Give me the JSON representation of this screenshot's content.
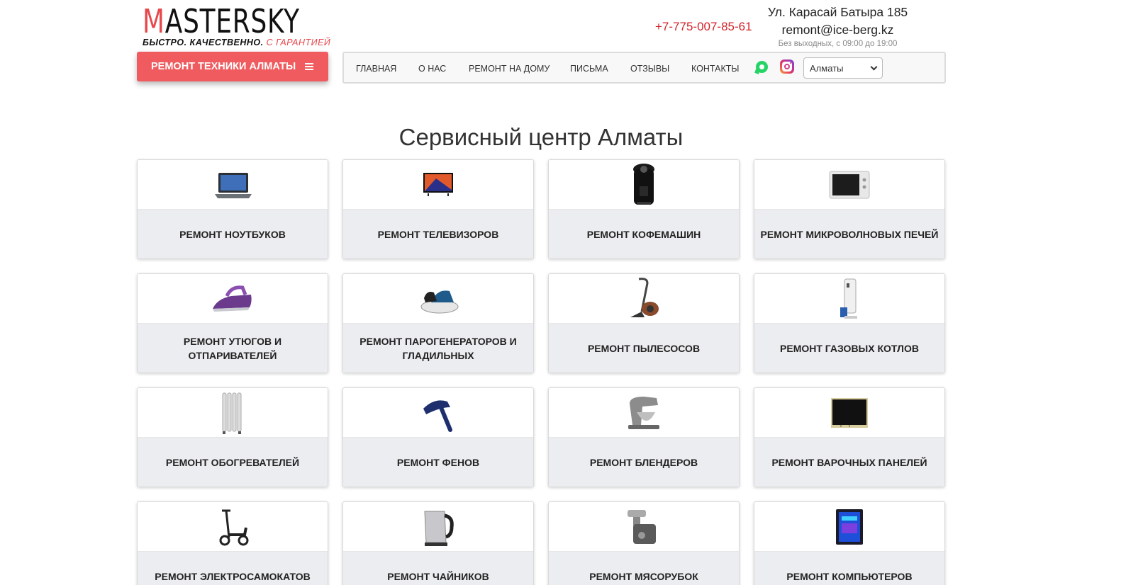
{
  "logo": {
    "first": "M",
    "rest": "ASTERSKY",
    "tagline_main": "БЫСТРО. КАЧЕСТВЕННО.",
    "tagline_accent": "С ГАРАНТИЕЙ"
  },
  "contacts": {
    "phone": "+7-775-007-85-61",
    "address": "Ул. Карасай Батыра 185",
    "email": "remont@ice-berg.kz",
    "hours": "Без выходных, с 09:00 до 19:00"
  },
  "category_button": {
    "label": "РЕМОНТ ТЕХНИКИ АЛМАТЫ",
    "icon": "hamburger-icon"
  },
  "nav": {
    "items": [
      "ГЛАВНАЯ",
      "О НАС",
      "РЕМОНТ НА ДОМУ",
      "ПИСЬМА",
      "ОТЗЫВЫ",
      "КОНТАКТЫ"
    ],
    "social": [
      "whatsapp-icon",
      "instagram-icon"
    ],
    "city_select": {
      "selected": "Алматы"
    }
  },
  "page_title": "Сервисный центр Алматы",
  "services": [
    {
      "label": "РЕМОНТ НОУТБУКОВ",
      "icon": "laptop-icon"
    },
    {
      "label": "РЕМОНТ ТЕЛЕВИЗОРОВ",
      "icon": "tv-icon"
    },
    {
      "label": "РЕМОНТ КОФЕМАШИН",
      "icon": "coffee-machine-icon"
    },
    {
      "label": "РЕМОНТ МИКРОВОЛНОВЫХ ПЕЧЕЙ",
      "icon": "microwave-icon"
    },
    {
      "label": "РЕМОНТ УТЮГОВ И ОТПАРИВАТЕЛЕЙ",
      "icon": "iron-icon"
    },
    {
      "label": "РЕМОНТ ПАРОГЕНЕРАТОРОВ И ГЛАДИЛЬНЫХ",
      "icon": "steam-generator-icon"
    },
    {
      "label": "РЕМОНТ ПЫЛЕСОСОВ",
      "icon": "vacuum-cleaner-icon"
    },
    {
      "label": "РЕМОНТ ГАЗОВЫХ КОТЛОВ",
      "icon": "gas-boiler-icon"
    },
    {
      "label": "РЕМОНТ ОБОГРЕВАТЕЛЕЙ",
      "icon": "heater-icon"
    },
    {
      "label": "РЕМОНТ ФЕНОВ",
      "icon": "hair-dryer-icon"
    },
    {
      "label": "РЕМОНТ БЛЕНДЕРОВ",
      "icon": "blender-icon"
    },
    {
      "label": "РЕМОНТ ВАРОЧНЫХ ПАНЕЛЕЙ",
      "icon": "cooktop-icon"
    },
    {
      "label": "РЕМОНТ ЭЛЕКТРОСАМОКАТОВ",
      "icon": "electric-scooter-icon"
    },
    {
      "label": "РЕМОНТ ЧАЙНИКОВ",
      "icon": "kettle-icon"
    },
    {
      "label": "РЕМОНТ МЯСОРУБОК",
      "icon": "meat-grinder-icon"
    },
    {
      "label": "РЕМОНТ КОМПЬЮТЕРОВ",
      "icon": "computer-icon"
    }
  ],
  "colors": {
    "accent": "#ef5b5e",
    "phone": "#d2232a",
    "card_label_bg": "#ecedf0",
    "nav_bg": "#f8f8f8"
  }
}
